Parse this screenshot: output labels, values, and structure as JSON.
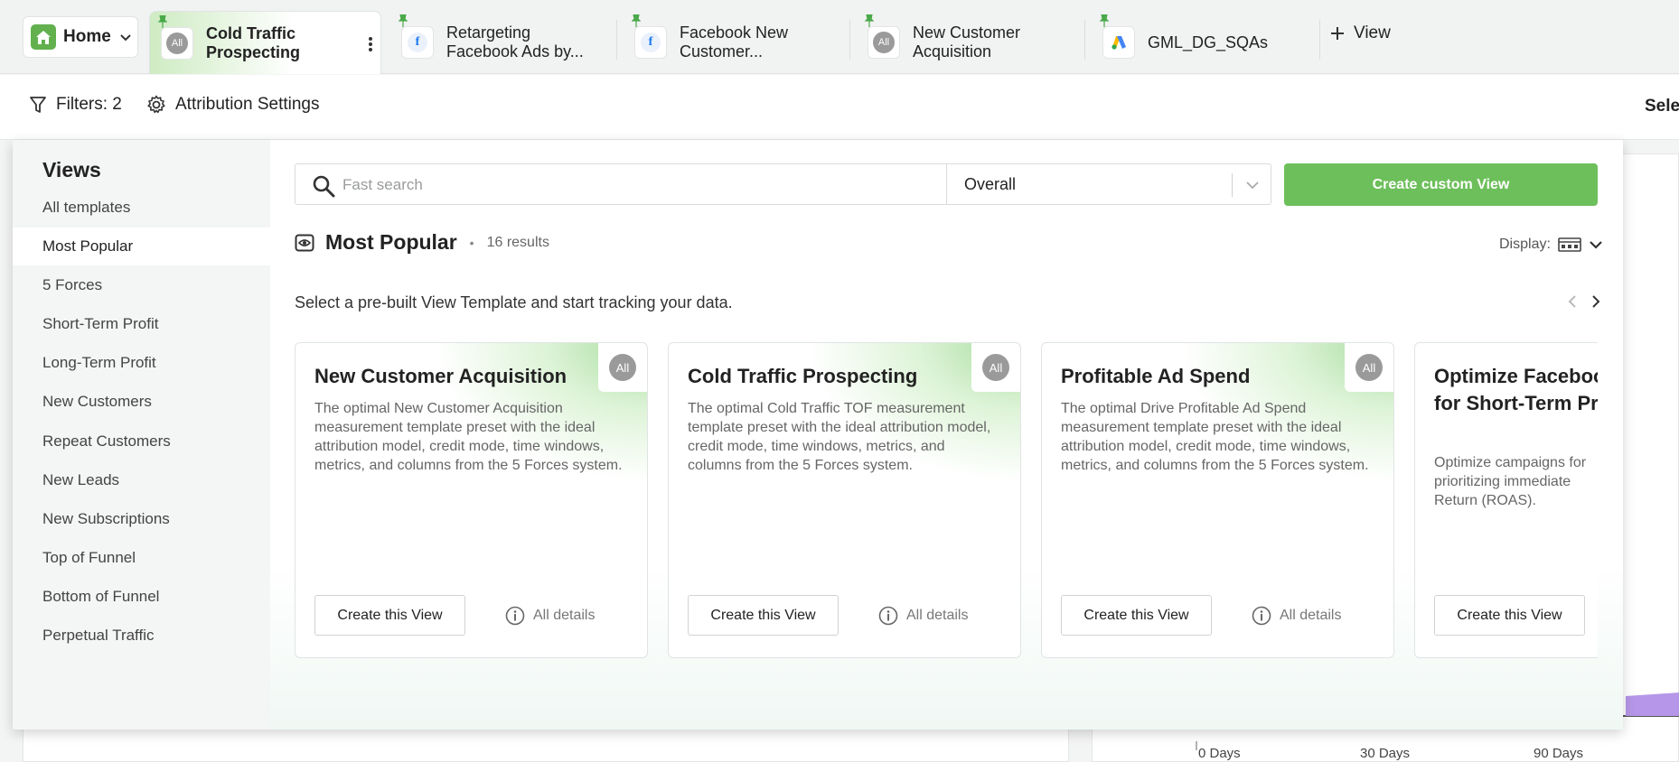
{
  "tabs": {
    "home_label": "Home",
    "items": [
      {
        "label_line1": "Cold Traffic",
        "label_line2": "Prospecting",
        "icon": "all-icon",
        "icon_text": "All"
      },
      {
        "label_line1": "Retargeting",
        "label_line2": "Facebook Ads by...",
        "icon": "facebook-icon",
        "icon_text": "f"
      },
      {
        "label_line1": "Facebook New",
        "label_line2": "Customer...",
        "icon": "facebook-icon",
        "icon_text": "f"
      },
      {
        "label_line1": "New Customer",
        "label_line2": "Acquisition",
        "icon": "all-icon",
        "icon_text": "All"
      },
      {
        "label_line1": "GML_DG_SQAs",
        "label_line2": "",
        "icon": "google-ads-icon",
        "icon_text": ""
      }
    ],
    "add_view_label": "View"
  },
  "toolbar": {
    "filters_label": "Filters: 2",
    "attribution_label": "Attribution Settings",
    "select_label_cut": "Selec"
  },
  "background": {
    "axis_labels": [
      "0 Days",
      "30 Days",
      "90 Days"
    ]
  },
  "sidebar": {
    "title": "Views",
    "items": [
      {
        "label": "All templates"
      },
      {
        "label": "Most Popular"
      },
      {
        "label": "5 Forces"
      },
      {
        "label": "Short-Term Profit"
      },
      {
        "label": "Long-Term Profit"
      },
      {
        "label": "New Customers"
      },
      {
        "label": "Repeat Customers"
      },
      {
        "label": "New Leads"
      },
      {
        "label": "New Subscriptions"
      },
      {
        "label": "Top of Funnel"
      },
      {
        "label": "Bottom of Funnel"
      },
      {
        "label": "Perpetual Traffic"
      }
    ],
    "active_index": 1
  },
  "search": {
    "placeholder": "Fast search",
    "value": ""
  },
  "filter_select": {
    "value": "Overall"
  },
  "create_button_label": "Create custom View",
  "section": {
    "title": "Most Popular",
    "count": "16 results",
    "display_label": "Display:",
    "subtitle": "Select a pre-built View Template and start tracking your data."
  },
  "cards": [
    {
      "title": "New Customer Acquisition",
      "badge": "All",
      "description": "The optimal New Customer Acquisition measurement template preset with the ideal attribution model, credit mode, time windows, metrics, and columns from the 5 Forces system.",
      "button": "Create this View",
      "details": "All details"
    },
    {
      "title": "Cold Traffic Prospecting",
      "badge": "All",
      "description": "The optimal Cold Traffic TOF measurement template preset with the ideal attribution model, credit mode, time windows, metrics, and columns from the 5 Forces system.",
      "button": "Create this View",
      "details": "All details"
    },
    {
      "title": "Profitable Ad Spend",
      "badge": "All",
      "description": "The optimal Drive Profitable Ad Spend measurement template preset with the ideal attribution model, credit mode, time windows, metrics, and columns from the 5 Forces system.",
      "button": "Create this View",
      "details": "All details"
    },
    {
      "title": "Optimize Facebook Campaigns for Short-Term Profit",
      "badge": "",
      "description": "Optimize campaigns for prioritizing immediate Return (ROAS).",
      "button": "Create this View",
      "details": ""
    }
  ],
  "colors": {
    "accent_green": "#6dbf5b",
    "home_green": "#62b04e",
    "facebook_blue": "#1877f2"
  }
}
